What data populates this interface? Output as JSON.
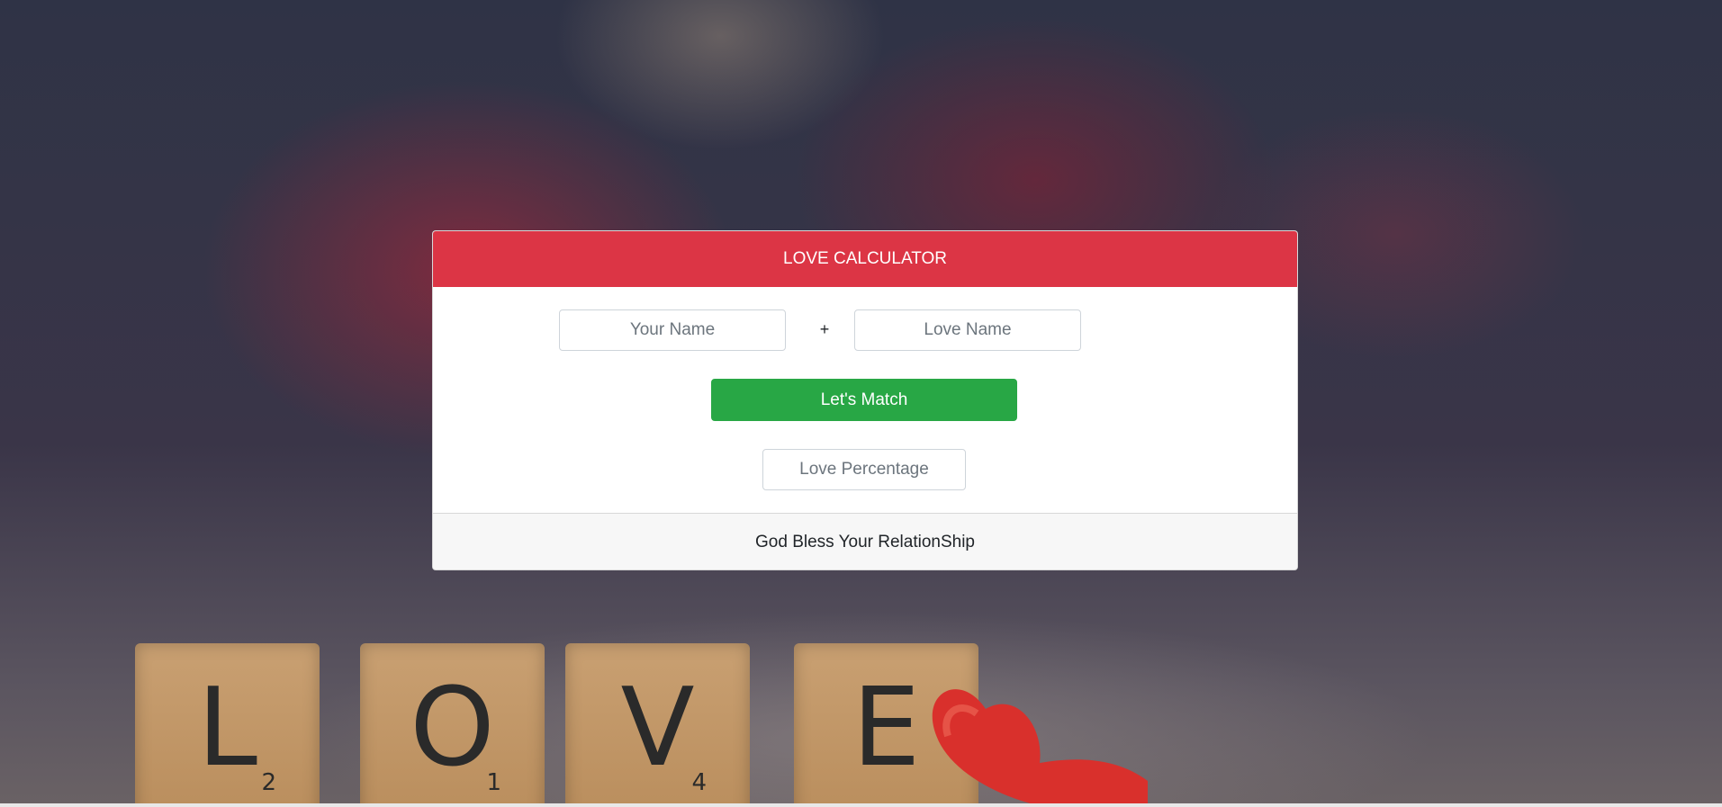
{
  "header": {
    "title": "LOVE CALCULATOR"
  },
  "form": {
    "your_name_placeholder": "Your Name",
    "plus_sign": "+",
    "love_name_placeholder": "Love Name",
    "match_button_label": "Let's Match",
    "love_percentage_placeholder": "Love Percentage"
  },
  "footer": {
    "message": "God Bless Your RelationShip"
  },
  "background": {
    "tiles": [
      {
        "letter": "L",
        "number": "2"
      },
      {
        "letter": "O",
        "number": "1"
      },
      {
        "letter": "V",
        "number": "4"
      },
      {
        "letter": "E",
        "number": ""
      }
    ]
  },
  "colors": {
    "header_red": "#dc3545",
    "button_green": "#28a745",
    "footer_gray": "#f7f7f7"
  }
}
